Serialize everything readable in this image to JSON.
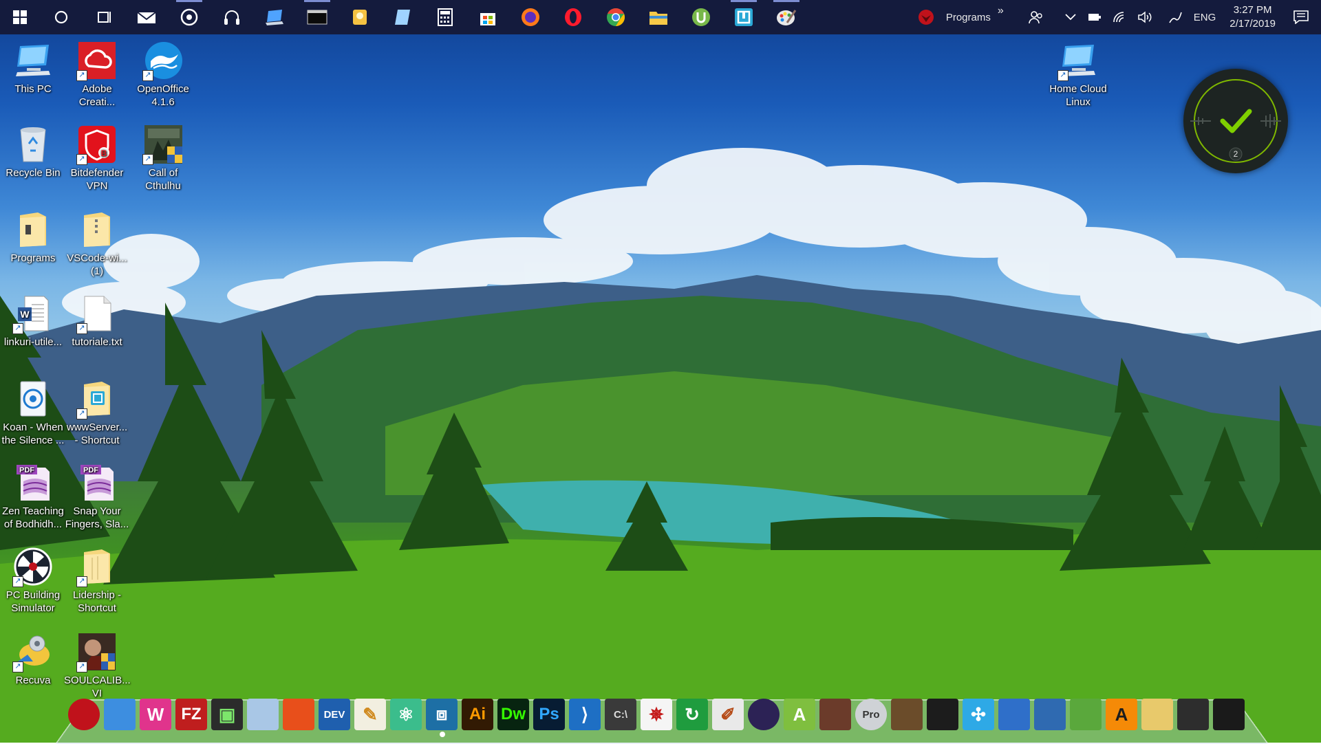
{
  "taskbar": {
    "pinned": [
      {
        "name": "windows-start-icon",
        "color": "#ffffff"
      },
      {
        "name": "cortana-search-icon",
        "color": "#ffffff"
      },
      {
        "name": "task-view-icon",
        "color": "#ffffff"
      },
      {
        "name": "mail-icon",
        "color": "#ffffff"
      },
      {
        "name": "groove-music-icon",
        "color": "#ffffff"
      },
      {
        "name": "headphones-icon",
        "color": "#ffffff"
      },
      {
        "name": "laptop-icon",
        "color": "#4fa3ff"
      },
      {
        "name": "terminal-icon",
        "color": "#cccccc"
      },
      {
        "name": "tips-bulb-icon",
        "color": "#f5c242"
      },
      {
        "name": "notes-icon",
        "color": "#9fd3ff"
      },
      {
        "name": "calculator-icon",
        "color": "#ffffff"
      },
      {
        "name": "store-icon",
        "color": "#ffffff"
      },
      {
        "name": "firefox-icon",
        "color": "#ff7a1a"
      },
      {
        "name": "opera-icon",
        "color": "#ff1b2d"
      },
      {
        "name": "chrome-icon",
        "color": "#34a853"
      },
      {
        "name": "file-explorer-icon",
        "color": "#f7c948"
      },
      {
        "name": "utorrent-icon",
        "color": "#78b84a"
      },
      {
        "name": "bracket-app-icon",
        "color": "#2aa8d6"
      },
      {
        "name": "paint-icon",
        "color": "#e8e8e8"
      }
    ],
    "tray": {
      "programs_label": "Programs",
      "chevron": "»",
      "language": "ENG",
      "time": "3:27 PM",
      "date": "2/17/2019"
    }
  },
  "desktop_icons": [
    {
      "label": "This PC",
      "icon": "this-pc-icon",
      "shortcut": false
    },
    {
      "label": "Adobe Creati...",
      "icon": "adobe-creative-cloud-icon",
      "shortcut": true
    },
    {
      "label": "OpenOffice 4.1.6",
      "icon": "openoffice-icon",
      "shortcut": true
    },
    {
      "label": "Recycle Bin",
      "icon": "recycle-bin-icon",
      "shortcut": false
    },
    {
      "label": "Bitdefender VPN",
      "icon": "bitdefender-vpn-icon",
      "shortcut": true
    },
    {
      "label": "Call of Cthulhu",
      "icon": "call-of-cthulhu-icon",
      "shortcut": true
    },
    {
      "label": "Programs",
      "icon": "folder-icon",
      "shortcut": false
    },
    {
      "label": "VSCode-wi... (1)",
      "icon": "zip-folder-icon",
      "shortcut": false
    },
    {
      "label": "linkuri-utile...",
      "icon": "word-document-icon",
      "shortcut": true
    },
    {
      "label": "tutoriale.txt",
      "icon": "text-file-icon",
      "shortcut": true
    },
    {
      "label": "Koan - When the Silence ...",
      "icon": "koan-app-icon",
      "shortcut": false
    },
    {
      "label": "wwwServer... - Shortcut",
      "icon": "folder-shortcut-icon",
      "shortcut": true
    },
    {
      "label": "Zen Teaching of Bodhidh...",
      "icon": "pdf-icon",
      "shortcut": false
    },
    {
      "label": "Snap Your Fingers, Sla...",
      "icon": "pdf-icon",
      "shortcut": false
    },
    {
      "label": "PC Building Simulator",
      "icon": "pc-building-simulator-icon",
      "shortcut": true
    },
    {
      "label": "Lidership - Shortcut",
      "icon": "folder-shortcut-icon",
      "shortcut": true
    },
    {
      "label": "Recuva",
      "icon": "recuva-icon",
      "shortcut": true
    },
    {
      "label": "SOULCALIB... VI",
      "icon": "soulcalibur-icon",
      "shortcut": true
    },
    {
      "label": "Home Cloud Linux",
      "icon": "home-cloud-pc-icon",
      "shortcut": true
    }
  ],
  "widget": {
    "count": "2"
  },
  "dock": {
    "items": [
      {
        "name": "red-sphere-app-icon",
        "text": "",
        "bg": "#c0121b",
        "fg": "#ffffff"
      },
      {
        "name": "laptop-dock-icon",
        "text": "",
        "bg": "#3d8ee0",
        "fg": "#ffffff"
      },
      {
        "name": "wamp-icon",
        "text": "W",
        "bg": "#e0348c",
        "fg": "#ffffff"
      },
      {
        "name": "filezilla-icon",
        "text": "FZ",
        "bg": "#bf1e1e",
        "fg": "#ffffff"
      },
      {
        "name": "console-icon",
        "text": "▣",
        "bg": "#2b2b2b",
        "fg": "#7ce66b"
      },
      {
        "name": "cube-icon",
        "text": "",
        "bg": "#a9c7e6",
        "fg": "#ffffff"
      },
      {
        "name": "office-icon",
        "text": "",
        "bg": "#e84f1b",
        "fg": "#ffffff"
      },
      {
        "name": "dev-cpp-icon",
        "text": "DEV",
        "bg": "#1f5fae",
        "fg": "#ffffff"
      },
      {
        "name": "pencil-icon",
        "text": "✎",
        "bg": "#f2efe0",
        "fg": "#d08a1e"
      },
      {
        "name": "atom-icon",
        "text": "⚛",
        "bg": "#3bbd8c",
        "fg": "#ffffff"
      },
      {
        "name": "bracket-dock-icon",
        "text": "⧈",
        "bg": "#1d6fa5",
        "fg": "#ffffff"
      },
      {
        "name": "illustrator-icon",
        "text": "Ai",
        "bg": "#321a03",
        "fg": "#ff9a00"
      },
      {
        "name": "dreamweaver-icon",
        "text": "Dw",
        "bg": "#072410",
        "fg": "#35fa00"
      },
      {
        "name": "photoshop-icon",
        "text": "Ps",
        "bg": "#071c33",
        "fg": "#31a8ff"
      },
      {
        "name": "vscode-icon",
        "text": "⟩",
        "bg": "#1e6fc4",
        "fg": "#ffffff"
      },
      {
        "name": "cmd-icon",
        "text": "C:\\",
        "bg": "#3a3a3a",
        "fg": "#dddddd"
      },
      {
        "name": "spider-web-icon",
        "text": "✵",
        "bg": "#f5f5f5",
        "fg": "#c41b1b"
      },
      {
        "name": "refresh-icon",
        "text": "↻",
        "bg": "#1f9c3e",
        "fg": "#ffffff"
      },
      {
        "name": "paint-brushes-icon",
        "text": "✐",
        "bg": "#e9e9e9",
        "fg": "#b54a16"
      },
      {
        "name": "eclipse-icon",
        "text": "",
        "bg": "#2c2255",
        "fg": "#ffffff"
      },
      {
        "name": "android-studio-icon",
        "text": "A",
        "bg": "#7fbf3f",
        "fg": "#ffffff"
      },
      {
        "name": "game-icon",
        "text": "",
        "bg": "#6b3b2a",
        "fg": "#ffffff"
      },
      {
        "name": "pro-disk-icon",
        "text": "Pro",
        "bg": "#cfd2d6",
        "fg": "#333333"
      },
      {
        "name": "calibre-books-icon",
        "text": "",
        "bg": "#6b4c2a",
        "fg": "#ffffff"
      },
      {
        "name": "kindle-reader-icon",
        "text": "",
        "bg": "#1c1c1c",
        "fg": "#ffffff"
      },
      {
        "name": "fan-icon",
        "text": "✣",
        "bg": "#2ea9e6",
        "fg": "#ffffff"
      },
      {
        "name": "book-icon",
        "text": "",
        "bg": "#2f6fc9",
        "fg": "#ffffff"
      },
      {
        "name": "globe-monitor-icon",
        "text": "",
        "bg": "#2f6ab1",
        "fg": "#ffffff"
      },
      {
        "name": "map-document-icon",
        "text": "",
        "bg": "#5aa83c",
        "fg": "#ffffff"
      },
      {
        "name": "avast-icon",
        "text": "A",
        "bg": "#f58a07",
        "fg": "#1d1d1d"
      },
      {
        "name": "zip-folder-dock-icon",
        "text": "",
        "bg": "#e8c96b",
        "fg": "#ffffff"
      },
      {
        "name": "witcher-icon",
        "text": "",
        "bg": "#2d2d2d",
        "fg": "#c41b1b"
      },
      {
        "name": "xbox-icon",
        "text": "",
        "bg": "#1a1a1a",
        "fg": "#9bf00b"
      }
    ]
  }
}
